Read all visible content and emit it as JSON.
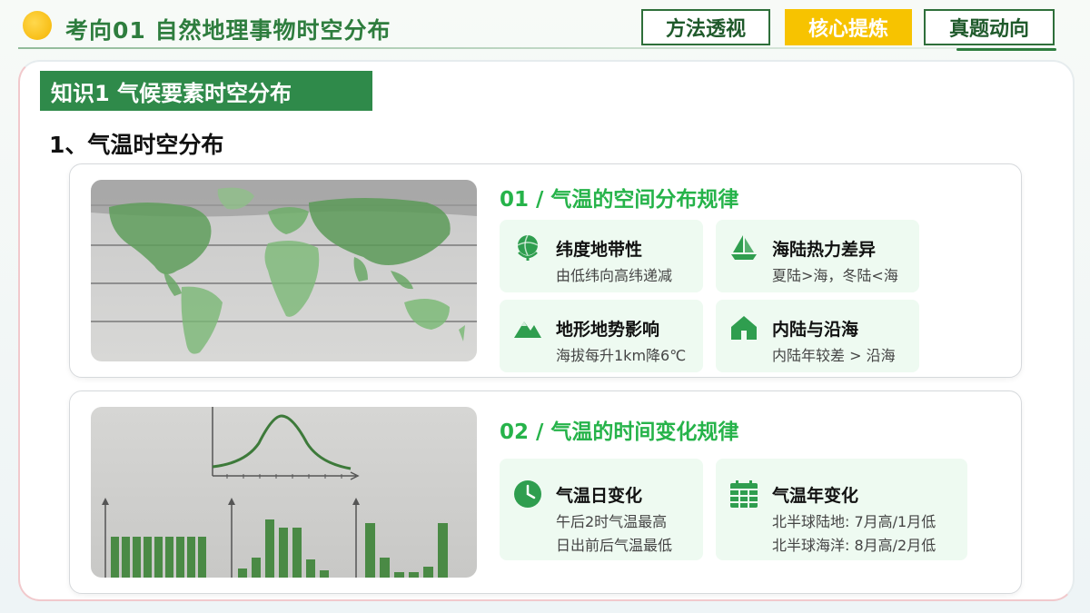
{
  "header": {
    "title": "考向01  自然地理事物时空分布",
    "nav": [
      {
        "label": "方法透视",
        "active": false
      },
      {
        "label": "核心提炼",
        "active": true
      },
      {
        "label": "真题动向",
        "active": false
      }
    ]
  },
  "knowledge": {
    "label": "知识1  气候要素时空分布",
    "section": "1、气温时空分布"
  },
  "cards": [
    {
      "heading": "01 / 气温的空间分布规律",
      "image": "world-map-illustration",
      "tiles": [
        {
          "icon": "globe-icon",
          "title": "纬度地带性",
          "lines": [
            "由低纬向高纬递减"
          ]
        },
        {
          "icon": "sailboat-icon",
          "title": "海陆热力差异",
          "lines": [
            "夏陆>海，冬陆<海"
          ]
        },
        {
          "icon": "mountain-icon",
          "title": "地形地势影响",
          "lines": [
            "海拔每升1km降6℃"
          ]
        },
        {
          "icon": "house-icon",
          "title": "内陆与沿海",
          "lines": [
            "内陆年较差 > 沿海"
          ]
        }
      ]
    },
    {
      "heading": "02 / 气温的时间变化规律",
      "image": "temperature-chart-illustration",
      "tiles": [
        {
          "icon": "clock-icon",
          "title": "气温日变化",
          "lines": [
            "午后2时气温最高",
            "日出前后气温最低"
          ]
        },
        {
          "icon": "calendar-icon",
          "title": "气温年变化",
          "lines": [
            "北半球陆地: 7月高/1月低",
            "北半球海洋: 8月高/2月低"
          ]
        }
      ]
    }
  ],
  "colors": {
    "primary_green": "#2f8a4a",
    "accent_green": "#26b34a",
    "nav_active": "#f7c300",
    "tile_bg": "#eefaf1"
  }
}
